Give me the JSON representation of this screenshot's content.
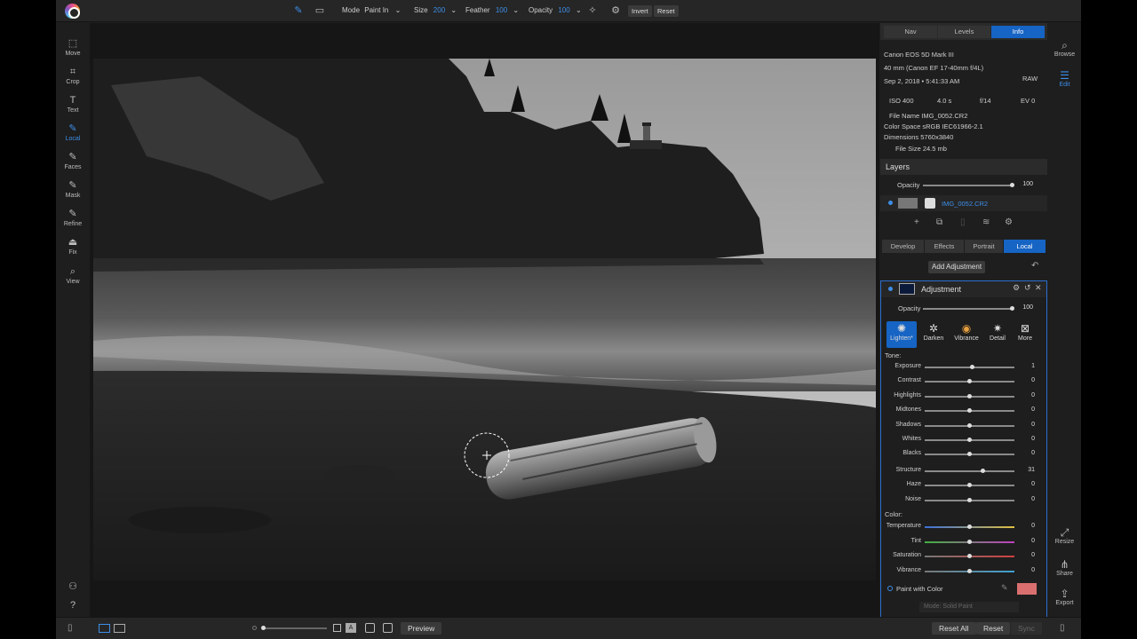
{
  "topbar": {
    "mode_label": "Mode",
    "mode_value": "Paint In",
    "size_label": "Size",
    "size_value": "200",
    "feather_label": "Feather",
    "feather_value": "100",
    "opacity_label": "Opacity",
    "opacity_value": "100",
    "invert_label": "Invert",
    "reset_label": "Reset"
  },
  "left_tools": [
    {
      "label": "Move",
      "icon": "move-icon"
    },
    {
      "label": "Crop",
      "icon": "crop-icon"
    },
    {
      "label": "Text",
      "icon": "text-icon"
    },
    {
      "label": "Local",
      "icon": "brush-icon",
      "active": true
    },
    {
      "label": "Faces",
      "icon": "faces-icon"
    },
    {
      "label": "Mask",
      "icon": "mask-icon"
    },
    {
      "label": "Refine",
      "icon": "refine-icon"
    },
    {
      "label": "Fix",
      "icon": "fix-icon"
    },
    {
      "label": "View",
      "icon": "view-icon"
    }
  ],
  "info_panel": {
    "tabs": [
      "Nav",
      "Levels",
      "Info"
    ],
    "active_tab": "Info",
    "camera": "Canon EOS 5D Mark III",
    "lens": "40 mm (Canon EF 17-40mm f/4L)",
    "date": "Sep 2, 2018 • 5:41:33 AM",
    "format": "RAW",
    "iso": "ISO 400",
    "shutter": "4.0 s",
    "aperture": "f/14",
    "ev": "EV 0",
    "file_name": "File Name IMG_0052.CR2",
    "color_space": "Color Space sRGB IEC61966-2.1",
    "dimensions": "Dimensions 5760x3840",
    "file_size": "File Size 24.5 mb"
  },
  "layers": {
    "title": "Layers",
    "opacity_label": "Opacity",
    "opacity_value": "100",
    "opacity_fraction": 1.0,
    "layer_name": "IMG_0052.CR2"
  },
  "module_tabs": [
    "Develop",
    "Effects",
    "Portrait",
    "Local"
  ],
  "active_module": "Local",
  "add_adjustment_label": "Add Adjustment",
  "adjustment": {
    "title": "Adjustment",
    "opacity_label": "Opacity",
    "opacity_value": "100",
    "filters": [
      {
        "label": "Lighten*",
        "icon": "lighten-icon",
        "active": true
      },
      {
        "label": "Darken",
        "icon": "darken-icon"
      },
      {
        "label": "Vibrance",
        "icon": "vibrance-icon"
      },
      {
        "label": "Detail",
        "icon": "detail-icon"
      },
      {
        "label": "More",
        "icon": "more-icon"
      }
    ],
    "tone_label": "Tone:",
    "tone_sliders": [
      {
        "label": "Exposure",
        "value": "1",
        "fraction": 0.53
      },
      {
        "label": "Contrast",
        "value": "0",
        "fraction": 0.5
      },
      {
        "label": "Highlights",
        "value": "0",
        "fraction": 0.5
      },
      {
        "label": "Midtones",
        "value": "0",
        "fraction": 0.5
      },
      {
        "label": "Shadows",
        "value": "0",
        "fraction": 0.5
      },
      {
        "label": "Whites",
        "value": "0",
        "fraction": 0.5
      },
      {
        "label": "Blacks",
        "value": "0",
        "fraction": 0.5
      },
      {
        "label": "Structure",
        "value": "31",
        "fraction": 0.65
      },
      {
        "label": "Haze",
        "value": "0",
        "fraction": 0.5
      },
      {
        "label": "Noise",
        "value": "0",
        "fraction": 0.5
      }
    ],
    "color_label": "Color:",
    "color_sliders": [
      {
        "label": "Temperature",
        "value": "0",
        "fraction": 0.5
      },
      {
        "label": "Tint",
        "value": "0",
        "fraction": 0.5
      },
      {
        "label": "Saturation",
        "value": "0",
        "fraction": 0.5
      },
      {
        "label": "Vibrance",
        "value": "0",
        "fraction": 0.5
      }
    ],
    "paint_with_color_label": "Paint with Color",
    "paint_color": "#d9706f",
    "mode_text": "Mode: Solid Paint"
  },
  "right_nav": [
    {
      "label": "Browse",
      "icon": "browse-icon"
    },
    {
      "label": "Edit",
      "icon": "edit-sliders-icon",
      "active": true
    },
    {
      "label": "Resize",
      "icon": "resize-icon"
    },
    {
      "label": "Share",
      "icon": "share-icon"
    },
    {
      "label": "Export",
      "icon": "export-icon"
    }
  ],
  "bottombar": {
    "preview_label": "Preview",
    "reset_all_label": "Reset All",
    "reset_label": "Reset",
    "sync_label": "Sync"
  },
  "colors": {
    "accent": "#1664c4",
    "accent_text": "#3d8ee8",
    "panel_bg": "#1e1e1e"
  }
}
